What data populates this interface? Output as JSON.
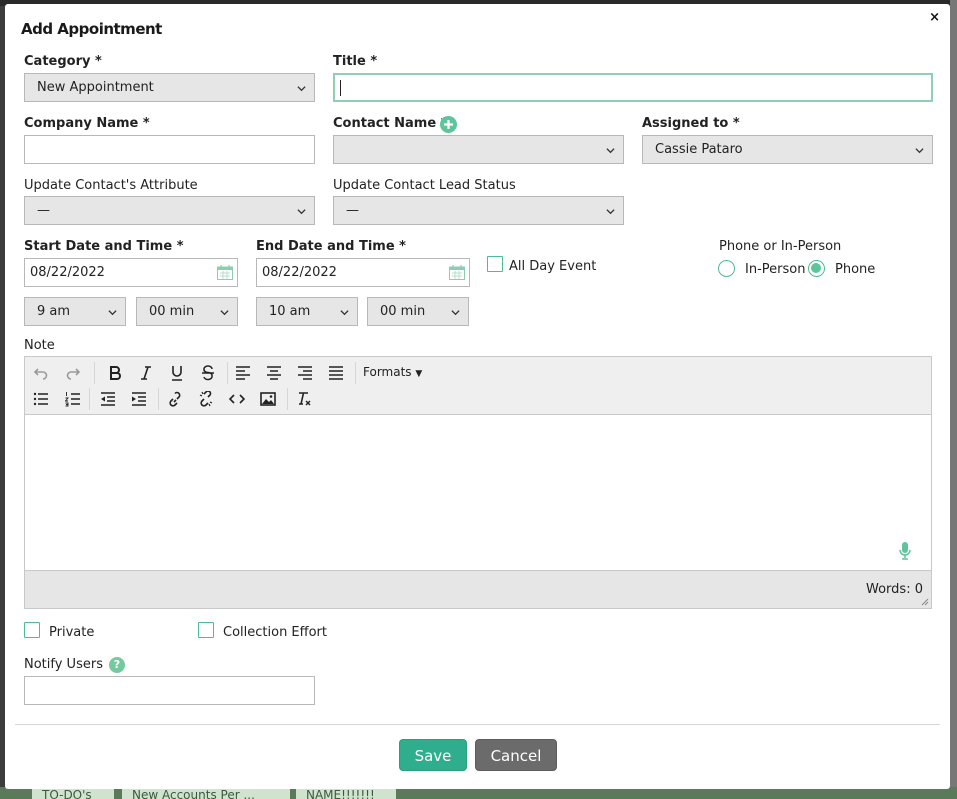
{
  "background": {
    "tabs": [
      "TO-DO's",
      "New Accounts Per ...",
      "NAME!!!!!!!"
    ]
  },
  "modal": {
    "title": "Add Appointment",
    "close_glyph": "×"
  },
  "form": {
    "category": {
      "label": "Category *",
      "value": "New Appointment"
    },
    "title_field": {
      "label": "Title *",
      "value": ""
    },
    "company_name": {
      "label": "Company Name *",
      "value": ""
    },
    "contact_name": {
      "label": "Contact Name *",
      "value": ""
    },
    "assigned_to": {
      "label": "Assigned to *",
      "value": "Cassie Pataro"
    },
    "update_attribute": {
      "label": "Update Contact's Attribute",
      "value": "—"
    },
    "update_lead_status": {
      "label": "Update Contact Lead Status",
      "value": "—"
    },
    "start": {
      "label": "Start Date and Time *",
      "date": "08/22/2022",
      "hour": "9 am",
      "minute": "00 min"
    },
    "end": {
      "label": "End Date and Time *",
      "date": "08/22/2022",
      "hour": "10 am",
      "minute": "00 min"
    },
    "all_day": {
      "label": "All Day Event",
      "checked": false
    },
    "phone_or_in_person": {
      "label": "Phone or In-Person",
      "options": [
        {
          "label": "In-Person",
          "selected": false
        },
        {
          "label": "Phone",
          "selected": true
        }
      ]
    },
    "note": {
      "label": "Note",
      "formats_label": "Formats",
      "word_count_label": "Words: 0"
    },
    "private": {
      "label": "Private",
      "checked": false
    },
    "collection_effort": {
      "label": "Collection Effort",
      "checked": false
    },
    "notify_users": {
      "label": "Notify Users",
      "value": "",
      "help_glyph": "?"
    }
  },
  "buttons": {
    "save": "Save",
    "cancel": "Cancel"
  },
  "colors": {
    "accent": "#5cc59c",
    "save": "#2fae8d",
    "cancel": "#6b6b6b",
    "focus_border": "#8fd0b4"
  }
}
